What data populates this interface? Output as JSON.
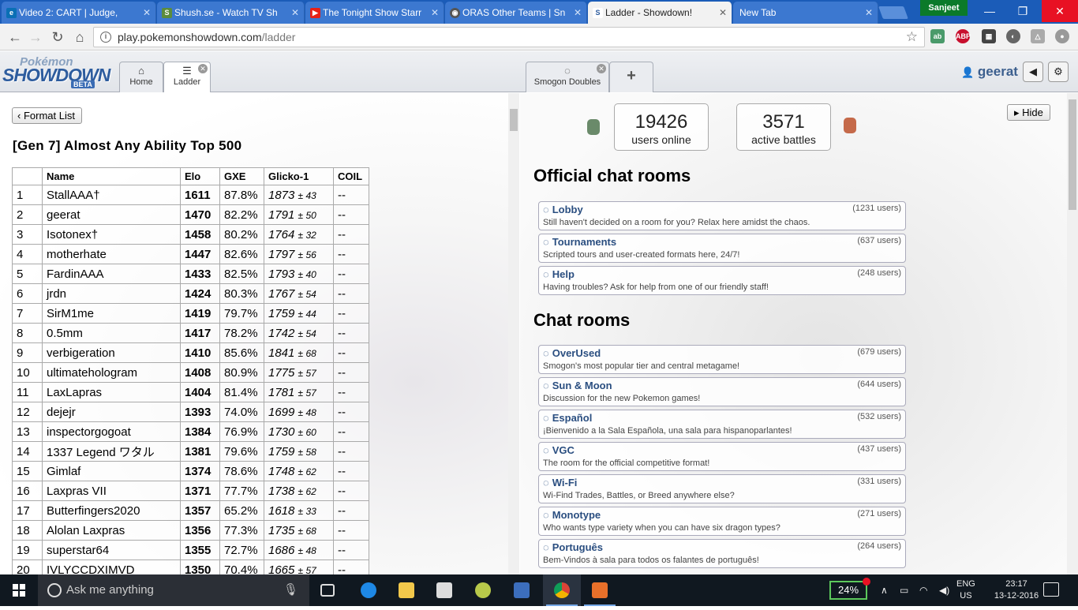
{
  "browser": {
    "tabs": [
      {
        "label": "Video 2: CART | Judge,",
        "icon": "edx-favicon",
        "color": "#e0e0e0"
      },
      {
        "label": "Shush.se - Watch TV Sh",
        "icon": "shush-favicon",
        "color": "#5c8c3c"
      },
      {
        "label": "The Tonight Show Starr",
        "icon": "youtube-favicon",
        "color": "#e62117"
      },
      {
        "label": "ORAS Other Teams | Sn",
        "icon": "smogon-favicon",
        "color": "#555555"
      },
      {
        "label": "Ladder - Showdown!",
        "icon": "showdown-favicon",
        "color": "#ffffff"
      },
      {
        "label": "New Tab",
        "icon": "",
        "color": ""
      }
    ],
    "profile_name": "Sanjeet",
    "url_host": "play.pokemonshowdown.com",
    "url_path": "/ladder"
  },
  "showdown": {
    "logo": {
      "top": "Pokémon",
      "main": "SHOWDOWN",
      "badge": "BETA"
    },
    "main_tabs": [
      {
        "label": "Home",
        "icon": "home-icon"
      },
      {
        "label": "Ladder",
        "icon": "list-icon"
      }
    ],
    "side_tabs": [
      {
        "label": "Smogon Doubles",
        "icon": "chat-bubble-icon"
      },
      {
        "label": "+",
        "icon": "plus-icon"
      }
    ],
    "username": "geerat"
  },
  "ladder": {
    "back_label": "Format List",
    "title": "[Gen 7] Almost Any Ability Top 500",
    "columns": [
      "",
      "Name",
      "Elo",
      "GXE",
      "Glicko-1",
      "COIL"
    ],
    "rows": [
      {
        "rank": "1",
        "name": "StallAAA†",
        "elo": "1611",
        "gxe": "87.8%",
        "glicko": "1873",
        "dev": "± 43",
        "coil": "--"
      },
      {
        "rank": "2",
        "name": "geerat",
        "elo": "1470",
        "gxe": "82.2%",
        "glicko": "1791",
        "dev": "± 50",
        "coil": "--"
      },
      {
        "rank": "3",
        "name": "Isotonex†",
        "elo": "1458",
        "gxe": "80.2%",
        "glicko": "1764",
        "dev": "± 32",
        "coil": "--"
      },
      {
        "rank": "4",
        "name": "motherhate",
        "elo": "1447",
        "gxe": "82.6%",
        "glicko": "1797",
        "dev": "± 56",
        "coil": "--"
      },
      {
        "rank": "5",
        "name": "FardinAAA",
        "elo": "1433",
        "gxe": "82.5%",
        "glicko": "1793",
        "dev": "± 40",
        "coil": "--"
      },
      {
        "rank": "6",
        "name": "jrdn",
        "elo": "1424",
        "gxe": "80.3%",
        "glicko": "1767",
        "dev": "± 54",
        "coil": "--"
      },
      {
        "rank": "7",
        "name": "SirM1me",
        "elo": "1419",
        "gxe": "79.7%",
        "glicko": "1759",
        "dev": "± 44",
        "coil": "--"
      },
      {
        "rank": "8",
        "name": "0.5mm",
        "elo": "1417",
        "gxe": "78.2%",
        "glicko": "1742",
        "dev": "± 54",
        "coil": "--"
      },
      {
        "rank": "9",
        "name": "verbigeration",
        "elo": "1410",
        "gxe": "85.6%",
        "glicko": "1841",
        "dev": "± 68",
        "coil": "--"
      },
      {
        "rank": "10",
        "name": "ultimatehologram",
        "elo": "1408",
        "gxe": "80.9%",
        "glicko": "1775",
        "dev": "± 57",
        "coil": "--"
      },
      {
        "rank": "11",
        "name": "LaxLapras",
        "elo": "1404",
        "gxe": "81.4%",
        "glicko": "1781",
        "dev": "± 57",
        "coil": "--"
      },
      {
        "rank": "12",
        "name": "dejejr",
        "elo": "1393",
        "gxe": "74.0%",
        "glicko": "1699",
        "dev": "± 48",
        "coil": "--"
      },
      {
        "rank": "13",
        "name": "inspectorgogoat",
        "elo": "1384",
        "gxe": "76.9%",
        "glicko": "1730",
        "dev": "± 60",
        "coil": "--"
      },
      {
        "rank": "14",
        "name": "1337 Legend ワタル",
        "elo": "1381",
        "gxe": "79.6%",
        "glicko": "1759",
        "dev": "± 58",
        "coil": "--"
      },
      {
        "rank": "15",
        "name": "Gimlaf",
        "elo": "1374",
        "gxe": "78.6%",
        "glicko": "1748",
        "dev": "± 62",
        "coil": "--"
      },
      {
        "rank": "16",
        "name": "Laxpras VII",
        "elo": "1371",
        "gxe": "77.7%",
        "glicko": "1738",
        "dev": "± 62",
        "coil": "--"
      },
      {
        "rank": "17",
        "name": "Butterfingers2020",
        "elo": "1357",
        "gxe": "65.2%",
        "glicko": "1618",
        "dev": "± 33",
        "coil": "--"
      },
      {
        "rank": "18",
        "name": "Alolan Laxpras",
        "elo": "1356",
        "gxe": "77.3%",
        "glicko": "1735",
        "dev": "± 68",
        "coil": "--"
      },
      {
        "rank": "19",
        "name": "superstar64",
        "elo": "1355",
        "gxe": "72.7%",
        "glicko": "1686",
        "dev": "± 48",
        "coil": "--"
      },
      {
        "rank": "20",
        "name": "IVLYCCDXIMVD",
        "elo": "1350",
        "gxe": "70.4%",
        "glicko": "1665",
        "dev": "± 57",
        "coil": "--"
      }
    ]
  },
  "lobby": {
    "users_online": "19426",
    "users_online_label": "users online",
    "active_battles": "3571",
    "active_battles_label": "active battles",
    "hide_label": "Hide",
    "official_title": "Official chat rooms",
    "official_rooms": [
      {
        "name": "Lobby",
        "users": "(1231 users)",
        "desc": "Still haven't decided on a room for you? Relax here amidst the chaos."
      },
      {
        "name": "Tournaments",
        "users": "(637 users)",
        "desc": "Scripted tours and user-created formats here, 24/7!"
      },
      {
        "name": "Help",
        "users": "(248 users)",
        "desc": "Having troubles? Ask for help from one of our friendly staff!"
      }
    ],
    "chat_title": "Chat rooms",
    "chat_rooms": [
      {
        "name": "OverUsed",
        "users": "(679 users)",
        "desc": "Smogon's most popular tier and central metagame!"
      },
      {
        "name": "Sun & Moon",
        "users": "(644 users)",
        "desc": "Discussion for the new Pokemon games!"
      },
      {
        "name": "Español",
        "users": "(532 users)",
        "desc": "¡Bienvenido a la Sala Española, una sala para hispanoparlantes!"
      },
      {
        "name": "VGC",
        "users": "(437 users)",
        "desc": "The room for the official competitive format!"
      },
      {
        "name": "Wi-Fi",
        "users": "(331 users)",
        "desc": "Wi-Find Trades, Battles, or Breed anywhere else?"
      },
      {
        "name": "Monotype",
        "users": "(271 users)",
        "desc": "Who wants type variety when you can have six dragon types?"
      },
      {
        "name": "Português",
        "users": "(264 users)",
        "desc": "Bem-Vindos à sala para todos os falantes de português!"
      }
    ]
  },
  "taskbar": {
    "search_placeholder": "Ask me anything",
    "battery": "24%",
    "lang_top": "ENG",
    "lang_bottom": "US",
    "time": "23:17",
    "date": "13-12-2016"
  },
  "colors": {
    "chrome_frame": "#1b5cb8",
    "link_blue": "#2a4e80",
    "close_red": "#e81123"
  }
}
